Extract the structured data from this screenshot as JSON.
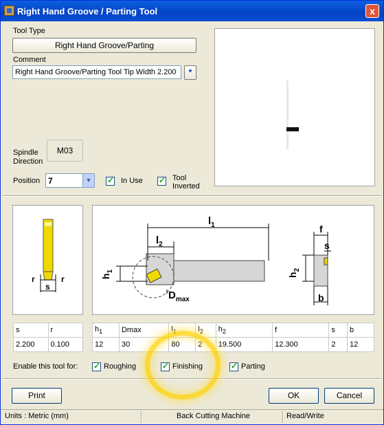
{
  "window": {
    "title": "Right Hand Groove / Parting Tool",
    "close_label": "x"
  },
  "tool_type": {
    "label": "Tool Type",
    "value": "Right Hand Groove/Parting"
  },
  "comment": {
    "label": "Comment",
    "value": "Right Hand Groove/Parting Tool Tip Width 2.200",
    "button_label": "*"
  },
  "spindle": {
    "label_line1": "Spindle",
    "label_line2": "Direction",
    "value": "M03"
  },
  "position": {
    "label": "Position",
    "value": "7"
  },
  "in_use": {
    "label": "In Use",
    "checked": true
  },
  "tool_inverted": {
    "label_line1": "Tool",
    "label_line2": "Inverted",
    "checked": true
  },
  "diagram_left": {
    "r_left": "r",
    "r_right": "r",
    "s": "s"
  },
  "diagram_main": {
    "l1": "l",
    "l1_sub": "1",
    "l2": "l",
    "l2_sub": "2",
    "h1": "h",
    "h1_sub": "1",
    "dmax": "D",
    "dmax_sub": "max",
    "f": "f",
    "s": "s",
    "h2": "h",
    "h2_sub": "2",
    "b": "b"
  },
  "table_small": {
    "headers": [
      "s",
      "r"
    ],
    "values": [
      "2.200",
      "0.100"
    ]
  },
  "table_main": {
    "headers": [
      [
        "h",
        "1"
      ],
      [
        "Dmax",
        ""
      ],
      [
        "l",
        "1"
      ],
      [
        "l",
        "2"
      ],
      [
        "h",
        "2"
      ],
      [
        "f",
        ""
      ],
      [
        "s",
        ""
      ],
      [
        "b",
        ""
      ]
    ],
    "values": [
      "12",
      "30",
      "80",
      "2",
      "19.500",
      "12.300",
      "2",
      "12"
    ]
  },
  "enable_for": {
    "label": "Enable this tool for:",
    "options": [
      {
        "label": "Roughing",
        "checked": true
      },
      {
        "label": "Finishing",
        "checked": true
      },
      {
        "label": "Parting",
        "checked": true
      }
    ]
  },
  "buttons": {
    "print": "Print",
    "ok": "OK",
    "cancel": "Cancel"
  },
  "status": {
    "units": "Units : Metric (mm)",
    "machine": "Back Cutting Machine",
    "mode": "Read/Write"
  },
  "colors": {
    "title_bar": "#0a4fd4",
    "tool_yellow": "#f0d800",
    "highlight": "#ffd200"
  }
}
